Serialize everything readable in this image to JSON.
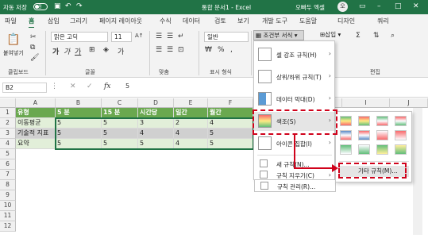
{
  "titlebar": {
    "autosave": "자동 저장",
    "autosave_state": "끔",
    "doc_title": "통합 문서1 - Excel",
    "user": "오빠두 엑셀",
    "avatar": "오",
    "accent": "#217346"
  },
  "tabs": [
    "파일",
    "홈",
    "삽입",
    "그리기",
    "페이지 레이아웃",
    "수식",
    "데이터",
    "검토",
    "보기",
    "개발 도구",
    "도움말",
    "디자인",
    "쿼리"
  ],
  "active_tab": "홈",
  "ribbon": {
    "paste": "붙여넣기",
    "font_name": "맑은 고딕",
    "font_size": "11",
    "number_format": "일반",
    "cond_format": "조건부 서식",
    "insert": "삽입",
    "groups": [
      "클립보드",
      "글꼴",
      "맞춤",
      "표시 형식",
      "편집"
    ]
  },
  "formula_bar": {
    "name_box": "B2",
    "fx": "fx",
    "value": "5"
  },
  "columns": [
    "A",
    "B",
    "C",
    "D",
    "E",
    "F",
    "G",
    "H",
    "I",
    "J"
  ],
  "rows": [
    "1",
    "2",
    "3",
    "4",
    "5",
    "6",
    "7",
    "8",
    "9",
    "10",
    "11",
    "12"
  ],
  "table": {
    "headers": [
      "유형",
      "5 분",
      "15 분",
      "시간당",
      "일간",
      "월간"
    ],
    "data": [
      [
        "이동평균",
        "5",
        "5",
        "3",
        "2",
        "4"
      ],
      [
        "기술적 지표",
        "5",
        "5",
        "4",
        "4",
        "5"
      ],
      [
        "요약",
        "5",
        "5",
        "5",
        "4",
        "5"
      ]
    ]
  },
  "cf_menu": {
    "items": [
      {
        "label": "셀 강조 규칙(H)",
        "icon": "highlight-rules-icon"
      },
      {
        "label": "상위/하위 규칙(T)",
        "icon": "top-bottom-icon"
      },
      {
        "label": "데이터 막대(D)",
        "icon": "data-bars-icon"
      },
      {
        "label": "색조(S)",
        "icon": "color-scales-icon"
      },
      {
        "label": "아이콘 집합(I)",
        "icon": "icon-sets-icon"
      }
    ],
    "small_items": [
      "새 규칙(N)...",
      "규칙 지우기(C)",
      "규칙 관리(R)..."
    ],
    "more_rules": "기타 규칙(M)..."
  },
  "highlight_color": "#d0021b"
}
